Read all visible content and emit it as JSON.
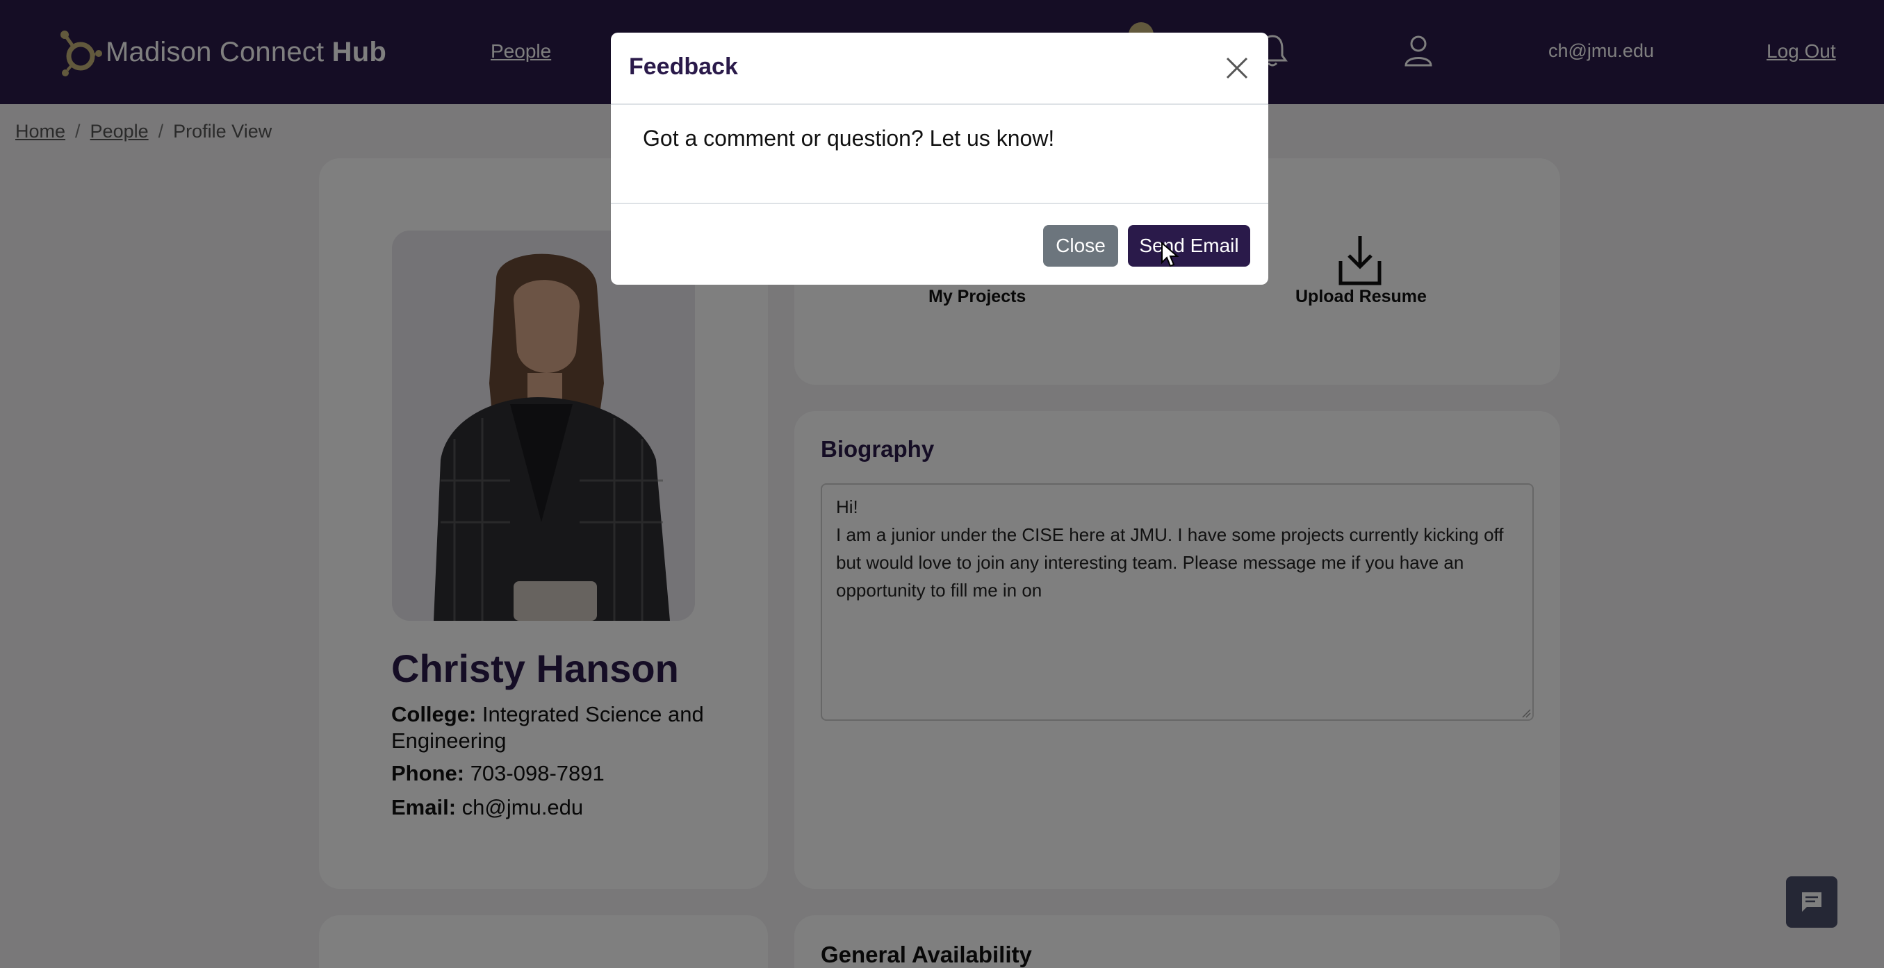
{
  "navbar": {
    "brand_regular": "Madison Connect",
    "brand_bold": "Hub",
    "people_link": "People",
    "user_email": "ch@jmu.edu",
    "logout_link": "Log Out"
  },
  "breadcrumb": {
    "home": "Home",
    "people": "People",
    "current": "Profile View",
    "separator": "/"
  },
  "profile": {
    "name": "Christy Hanson",
    "college_label": "College:",
    "college_value": "Integrated Science and Engineering",
    "phone_label": "Phone:",
    "phone_value": "703-098-7891",
    "email_label": "Email:",
    "email_value": "ch@jmu.edu"
  },
  "actions": {
    "my_projects": "My Projects",
    "upload_resume": "Upload Resume"
  },
  "biography": {
    "title": "Biography",
    "text": "Hi!\nI am a junior under the CISE here at JMU. I have some projects currently kicking off but would love to join any interesting team. Please message me if you have an opportunity to fill me in on"
  },
  "availability": {
    "title": "General Availability"
  },
  "modal": {
    "title": "Feedback",
    "body": "Got a comment or question? Let us know!",
    "close_button": "Close",
    "send_button": "Send Email"
  },
  "colors": {
    "brand_purple": "#2a1a4a",
    "secondary_gray": "#6c757d",
    "gold_accent": "#c5b27a"
  },
  "icons": [
    "hub-logo-icon",
    "bell-icon",
    "user-icon",
    "close-icon",
    "upload-icon",
    "chat-icon",
    "mouse-cursor-icon"
  ]
}
